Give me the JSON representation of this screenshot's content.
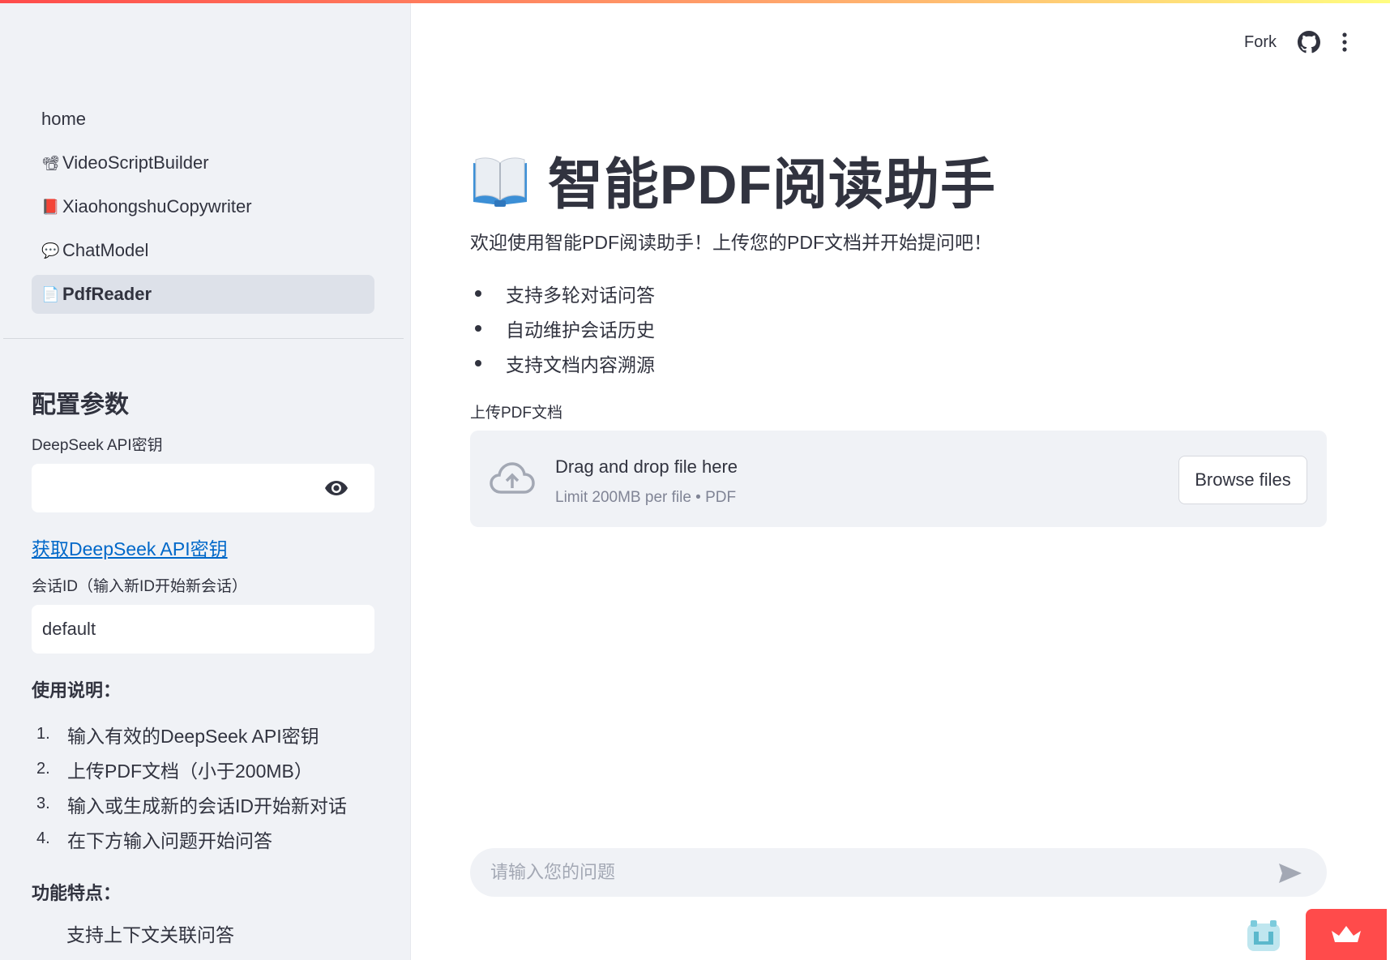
{
  "header": {
    "fork_label": "Fork",
    "icons": [
      "github-icon",
      "kebab-menu-icon"
    ]
  },
  "sidebar": {
    "nav": [
      {
        "label": "home",
        "icon": ""
      },
      {
        "label": "VideoScriptBuilder",
        "icon": "📽"
      },
      {
        "label": "XiaohongshuCopywriter",
        "icon": "📕"
      },
      {
        "label": "ChatModel",
        "icon": "💬"
      },
      {
        "label": "PdfReader",
        "icon": "📄",
        "active": true
      }
    ],
    "config_title": "配置参数",
    "api_key_label": "DeepSeek API密钥",
    "api_key_value": "",
    "api_link": "获取DeepSeek API密钥",
    "session_label": "会话ID（输入新ID开始新会话）",
    "session_value": "default",
    "usage_title": "使用说明：",
    "usage_steps": [
      "输入有效的DeepSeek API密钥",
      "上传PDF文档（小于200MB）",
      "输入或生成新的会话ID开始新对话",
      "在下方输入问题开始问答"
    ],
    "features_title": "功能特点：",
    "features_first": "支持上下文关联问答"
  },
  "main": {
    "title_icon": "open-book-icon",
    "title": "智能PDF阅读助手",
    "welcome": "欢迎使用智能PDF阅读助手！上传您的PDF文档并开始提问吧！",
    "features": [
      "支持多轮对话问答",
      "自动维护会话历史",
      "支持文档内容溯源"
    ],
    "upload_label": "上传PDF文档",
    "dropzone_title": "Drag and drop file here",
    "dropzone_limit": "Limit 200MB per file • PDF",
    "browse_button": "Browse files",
    "chat_placeholder": "请输入您的问题"
  },
  "colors": {
    "sidebar_bg": "#f0f2f6",
    "text": "#31333f",
    "link": "#0068c9",
    "badge": "#ff4b4b"
  }
}
